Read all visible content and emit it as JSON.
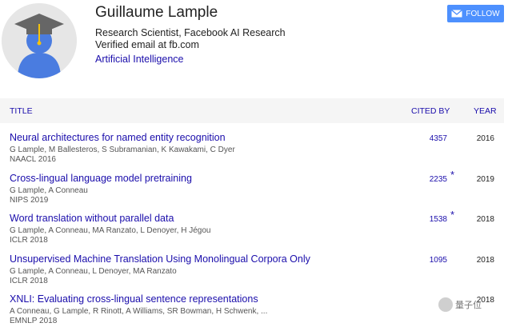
{
  "profile": {
    "name": "Guillaume Lample",
    "affiliation": "Research Scientist, Facebook AI Research",
    "email": "Verified email at fb.com",
    "interest": "Artificial Intelligence",
    "follow_label": "FOLLOW",
    "avatar_icon": "graduation-cap-user-icon"
  },
  "table": {
    "headers": {
      "title": "TITLE",
      "cited_by": "CITED BY",
      "year": "YEAR"
    },
    "rows": [
      {
        "title": "Neural architectures for named entity recognition",
        "authors": "G Lample, M Ballesteros, S Subramanian, K Kawakami, C Dyer",
        "venue": "NAACL 2016",
        "cited_by": "4357",
        "star": "",
        "year": "2016"
      },
      {
        "title": "Cross-lingual language model pretraining",
        "authors": "G Lample, A Conneau",
        "venue": "NIPS 2019",
        "cited_by": "2235",
        "star": "*",
        "year": "2019"
      },
      {
        "title": "Word translation without parallel data",
        "authors": "G Lample, A Conneau, MA Ranzato, L Denoyer, H Jégou",
        "venue": "ICLR 2018",
        "cited_by": "1538",
        "star": "*",
        "year": "2018"
      },
      {
        "title": "Unsupervised Machine Translation Using Monolingual Corpora Only",
        "authors": "G Lample, A Conneau, L Denoyer, MA Ranzato",
        "venue": "ICLR 2018",
        "cited_by": "1095",
        "star": "",
        "year": "2018"
      },
      {
        "title": "XNLI: Evaluating cross-lingual sentence representations",
        "authors": "A Conneau, G Lample, R Rinott, A Williams, SR Bowman, H Schwenk, ...",
        "venue": "EMNLP 2018",
        "cited_by": "",
        "star": "",
        "year": "2018"
      }
    ]
  },
  "watermark": {
    "text": "量子位"
  },
  "colors": {
    "link": "#1a0dab",
    "button": "#4d90fe",
    "header_bg": "#f5f5f5"
  }
}
